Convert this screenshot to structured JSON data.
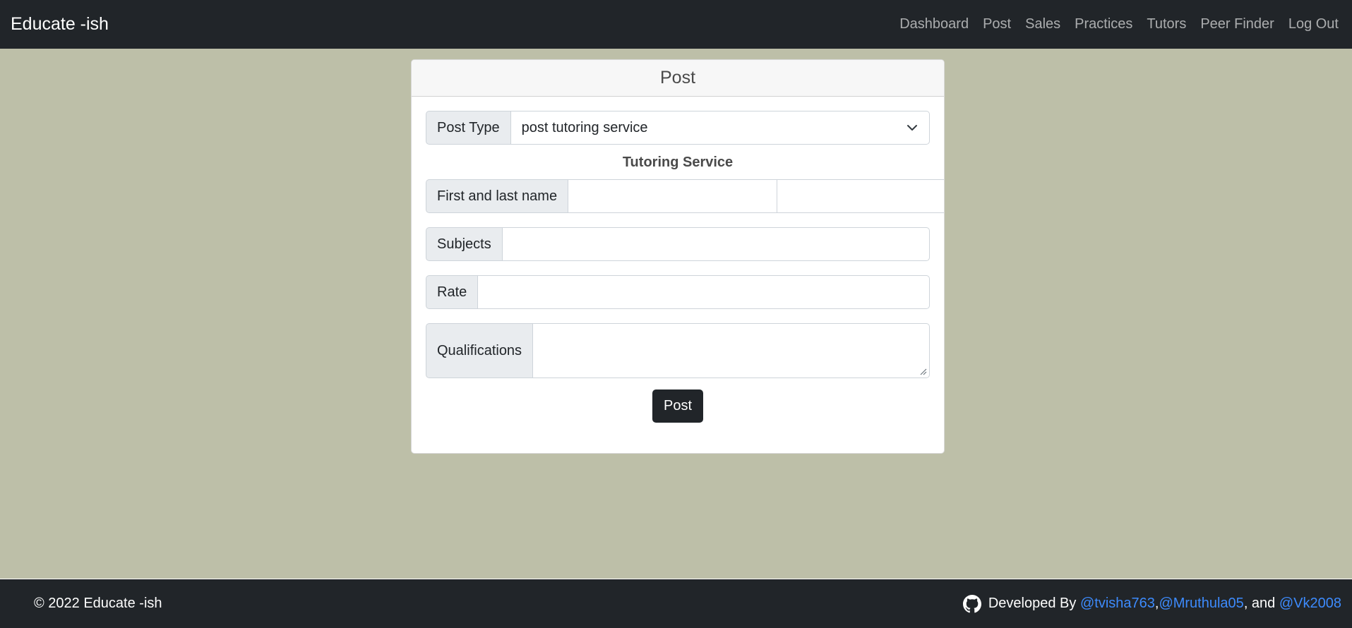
{
  "navbar": {
    "brand": "Educate -ish",
    "links": [
      "Dashboard",
      "Post",
      "Sales",
      "Practices",
      "Tutors",
      "Peer Finder",
      "Log Out"
    ]
  },
  "card": {
    "title": "Post",
    "post_type_label": "Post Type",
    "post_type_value": "post tutoring service",
    "section_title": "Tutoring Service",
    "name_label": "First and last name",
    "subjects_label": "Subjects",
    "rate_label": "Rate",
    "qualifications_label": "Qualifications",
    "submit_label": "Post"
  },
  "footer": {
    "copyright": "© 2022 Educate -ish",
    "developed_by": "Developed By",
    "devs": [
      "@tvisha763",
      "@Mruthula05",
      "@Vk2008"
    ],
    "sep1": ", ",
    "sep2": ", and "
  },
  "colors": {
    "background": "#bdbfa8",
    "navbar": "#212529",
    "link": "#3d8bfd"
  }
}
